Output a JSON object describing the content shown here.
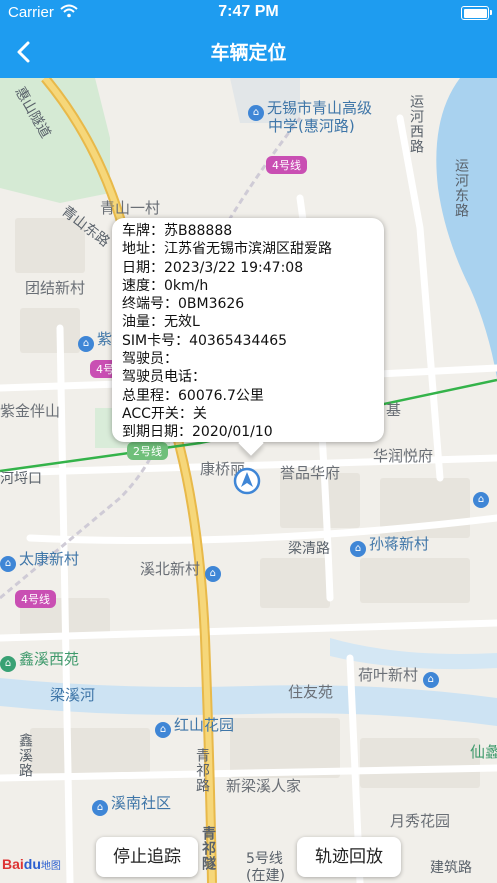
{
  "status_bar": {
    "carrier": "Carrier",
    "time": "7:47 PM"
  },
  "nav": {
    "title": "车辆定位",
    "back_icon": "chevron-left-icon"
  },
  "info": {
    "rows": [
      "车牌：苏B88888",
      "地址：江苏省无锡市滨湖区甜爱路",
      "日期：2023/3/22 19:47:08",
      "速度：0km/h",
      "终端号：0BM3626",
      "油量：无效L",
      "SIM卡号：40365434465",
      "驾驶员：",
      "驾驶员电话：",
      "总里程：60076.7公里",
      "ACC开关：关",
      "到期日期：2020/01/10"
    ]
  },
  "map": {
    "labels": {
      "school": "无锡市青山高级",
      "school_line2": "中学(惠河路)",
      "metro4_a": "4号线",
      "metro4_b": "4号线",
      "metro4_c": "4号线",
      "metro2": "2号线",
      "metro5": "5号线",
      "metro5_sub": "(在建)",
      "qingshan_yicun": "青山一村",
      "qingshan_east": "青山东路",
      "tuanjie": "团结新村",
      "zijin": "紫金伴山",
      "huixiang": "惠山隧道",
      "yunhe_west": "运河西路",
      "yunhe_east": "运河东路",
      "kangqiao": "康桥丽",
      "yupin": "誉品华府",
      "huarun": "华润悦府",
      "ji": "基",
      "heping": "河埒口",
      "taikang": "太康新村",
      "liangqing": "梁清路",
      "sunjiang": "孙蒋新村",
      "xibei": "溪北新村",
      "xinxi_west": "鑫溪西苑",
      "heye": "荷叶新村",
      "zhuyou": "住友苑",
      "liangxi_river": "梁溪河",
      "hongshan": "红山花园",
      "xinxi_road": "鑫溪路",
      "qingqi": "青祁路",
      "qingqi_tunnel": "青祁隧",
      "xinliangxi": "新梁溪人家",
      "xinan": "溪南社区",
      "yuexiu": "月秀花园",
      "jianzhu": "建筑路",
      "xian": "仙蠡",
      "zi": "紫"
    }
  },
  "buttons": {
    "stop": "停止追踪",
    "track": "轨迹回放"
  },
  "logo": {
    "brand": "Bai",
    "brand_paw": "du",
    "sub": "地图"
  }
}
